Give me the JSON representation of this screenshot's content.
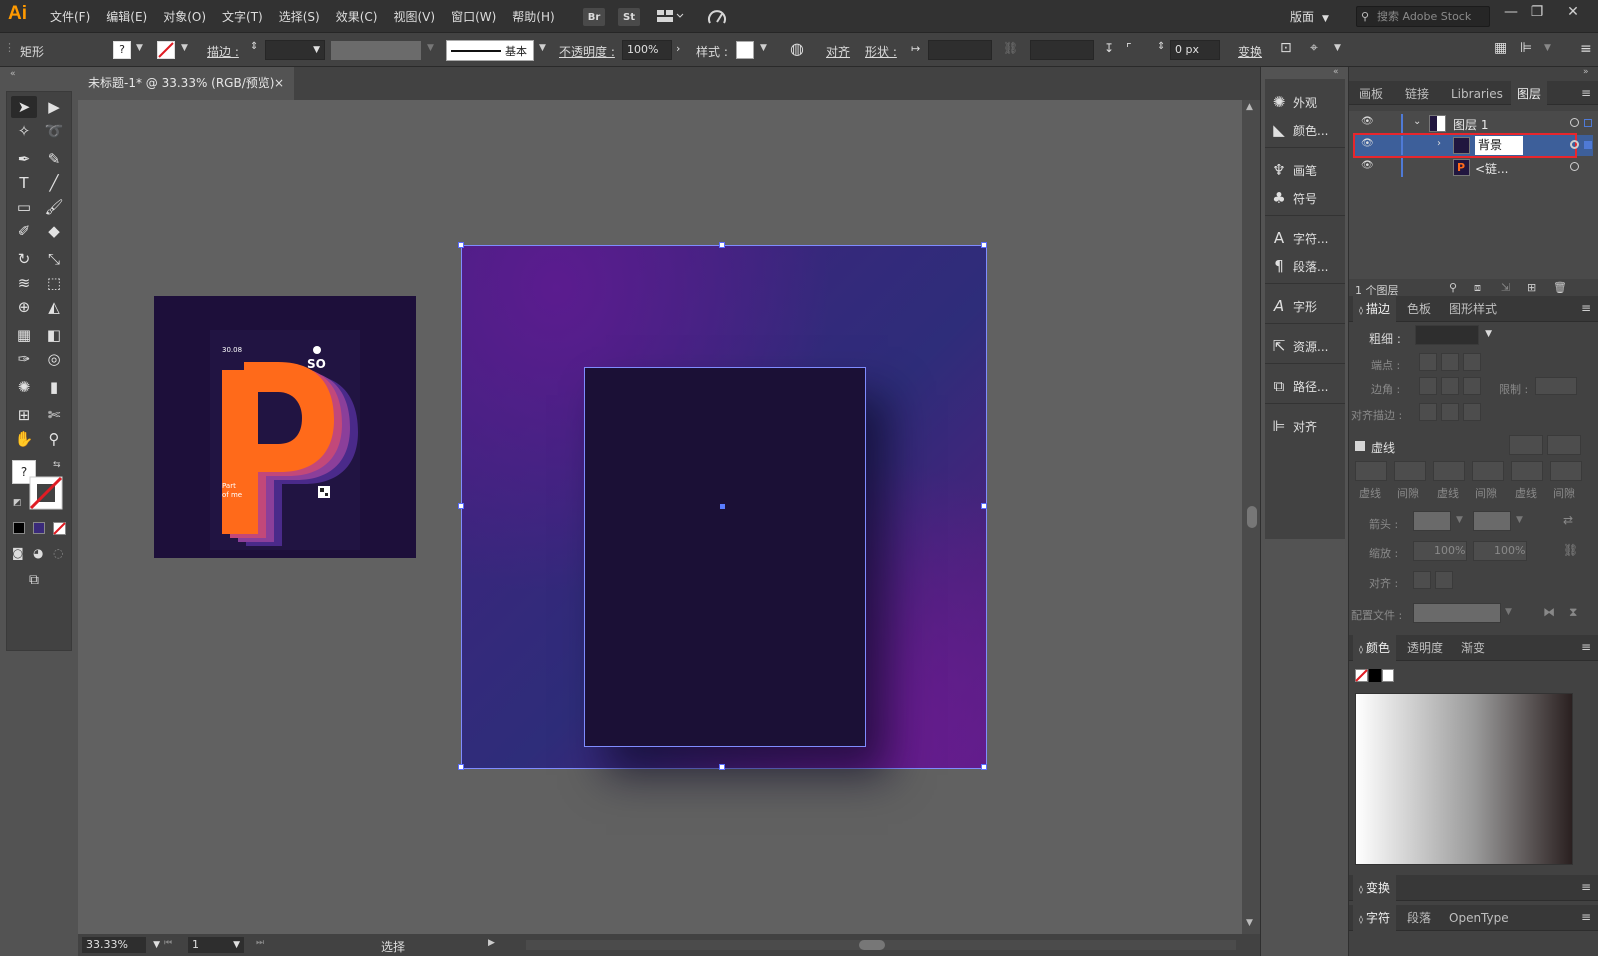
{
  "app": {
    "logo": "Ai",
    "menus": [
      "文件(F)",
      "编辑(E)",
      "对象(O)",
      "文字(T)",
      "选择(S)",
      "效果(C)",
      "视图(V)",
      "窗口(W)",
      "帮助(H)"
    ],
    "bridge": "Br",
    "stock": "St",
    "workspace": "版面",
    "search_placeholder": "搜索 Adobe Stock",
    "win_controls": [
      "—",
      "❐",
      "✕"
    ]
  },
  "control_bar": {
    "object_type": "矩形",
    "stroke_label": "描边 :",
    "stroke_style": "基本",
    "opacity_label": "不透明度 :",
    "opacity_value": "100%",
    "style_label": "样式 :",
    "align_label": "对齐",
    "shape_label": "形状 :",
    "corner_value": "0 px",
    "transform_label": "变换"
  },
  "document": {
    "tab_title": "未标题-1* @ 33.33% (RGB/预览)",
    "tab_close": "×"
  },
  "artwork_thumb": {
    "date": "30.08",
    "brand": "SO",
    "tagline": "Part\nof me"
  },
  "status_bar": {
    "zoom": "33.33%",
    "page": "1",
    "mode": "选择"
  },
  "dock": {
    "items": [
      {
        "icon": "sun-icon",
        "label": "外观"
      },
      {
        "icon": "color-icon",
        "label": "颜色..."
      },
      {
        "icon": "brush-icon",
        "label": "画笔"
      },
      {
        "icon": "club-icon",
        "label": "符号"
      },
      {
        "icon": "char-icon",
        "label": "字符..."
      },
      {
        "icon": "para-icon",
        "label": "段落..."
      },
      {
        "icon": "glyph-icon",
        "label": "字形"
      },
      {
        "icon": "export-icon",
        "label": "资源..."
      },
      {
        "icon": "pathfinder-icon",
        "label": "路径..."
      },
      {
        "icon": "align-icon",
        "label": "对齐"
      }
    ]
  },
  "layers_panel": {
    "tabs": [
      "画板",
      "链接",
      "Libraries",
      "图层"
    ],
    "active_tab": "图层",
    "layers": [
      {
        "name": "图层 1"
      },
      {
        "name": "背景"
      },
      {
        "name": "<链..."
      }
    ],
    "footer": "1 个图层"
  },
  "stroke_panel": {
    "tabs": [
      "描边",
      "色板",
      "图形样式"
    ],
    "weight_label": "粗细 :",
    "cap_label": "端点 :",
    "corner_label": "边角 :",
    "limit_label": "限制 :",
    "align_label": "对齐描边 :",
    "dashed_label": "虚线",
    "dash_labels": [
      "虚线",
      "间隙",
      "虚线",
      "间隙",
      "虚线",
      "间隙"
    ],
    "arrow_label": "箭头 :",
    "scale_label": "缩放 :",
    "scale_value1": "100%",
    "scale_value2": "100%",
    "align2_label": "对齐 :",
    "profile_label": "配置文件 :"
  },
  "color_panel": {
    "tabs": [
      "颜色",
      "透明度",
      "渐变"
    ]
  },
  "bottom_panels": {
    "transform": "变换",
    "char_tabs": [
      "字符",
      "段落",
      "OpenType"
    ]
  },
  "colors": {
    "accent": "#4f7ad6",
    "highlight_border": "#e8262c",
    "orange": "#ff6a1a"
  }
}
